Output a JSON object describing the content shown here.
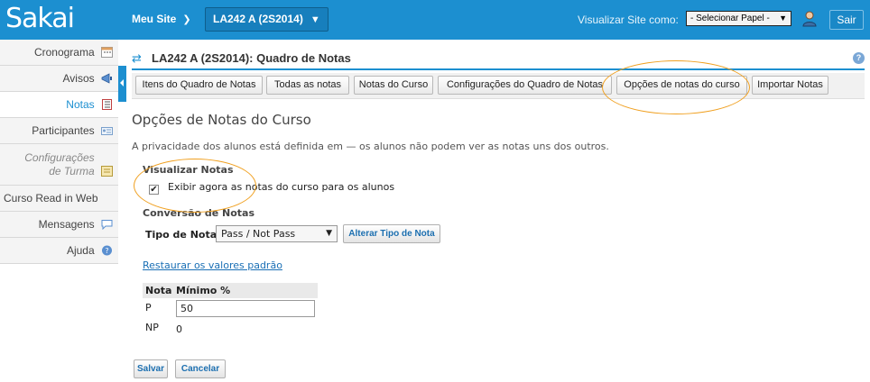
{
  "header": {
    "logo": "Sakai",
    "site_menu_label": "Meu Site",
    "course_label": "LA242 A (2S2014)",
    "view_as_label": "Visualizar Site como:",
    "role_select_value": "- Selecionar Papel -",
    "logout_label": "Sair"
  },
  "sidebar": {
    "items": [
      {
        "label": "Cronograma",
        "icon": "calendar-icon"
      },
      {
        "label": "Avisos",
        "icon": "megaphone-icon"
      },
      {
        "label": "Notas",
        "icon": "gradebook-icon",
        "active": true
      },
      {
        "label": "Participantes",
        "icon": "roster-icon"
      },
      {
        "label": "Configurações de Turma",
        "icon": "section-icon"
      },
      {
        "label": "Curso Read in Web",
        "icon": "window-icon"
      },
      {
        "label": "Mensagens",
        "icon": "speech-bubble-icon"
      },
      {
        "label": "Ajuda",
        "icon": "help-icon"
      }
    ]
  },
  "page": {
    "title": "LA242 A (2S2014): Quadro de Notas",
    "tabs": [
      "Itens do Quadro de Notas",
      "Todas as notas",
      "Notas do Curso",
      "Configurações do Quadro de Notas",
      "Opções de notas do curso",
      "Importar Notas"
    ],
    "section_title": "Opções de Notas do Curso",
    "privacy_text": "A privacidade dos alunos está definida em — os alunos não podem ver as notas uns dos outros.",
    "display_heading": "Visualizar Notas",
    "display_checkbox_label": "Exibir agora as notas do curso para os alunos",
    "display_checked": true,
    "conversion_heading": "Conversão de Notas",
    "grade_type_label": "Tipo de Nota",
    "grade_type_value": "Pass / Not Pass",
    "change_type_button": "Alterar Tipo de Nota",
    "restore_link": "Restaurar os valores padrão",
    "table": {
      "col_grade": "Nota",
      "col_min": "Mínimo %",
      "rows": [
        {
          "grade": "P",
          "min": "50"
        },
        {
          "grade": "NP",
          "min": "0"
        }
      ]
    },
    "save_button": "Salvar",
    "cancel_button": "Cancelar"
  },
  "colors": {
    "brand_blue": "#1c8fd0",
    "annotation_orange": "#f0a020"
  }
}
